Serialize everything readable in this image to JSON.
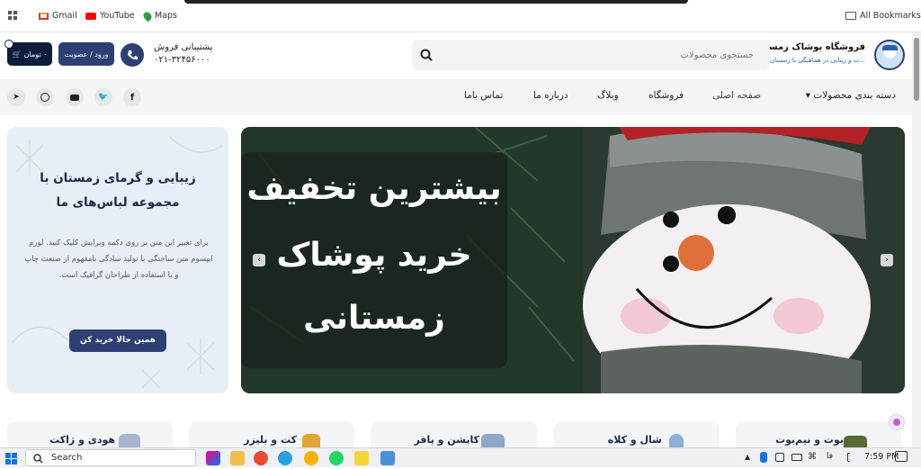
{
  "bookmarks": {
    "items": [
      {
        "label": "Gmail"
      },
      {
        "label": "YouTube"
      },
      {
        "label": "Maps"
      }
    ],
    "all_label": "All Bookmarks"
  },
  "header": {
    "logo_title": "فروشگاه پوشاک زمستانه",
    "logo_sub": "...ت و زیبایی در هماهنگی با زمستان",
    "search_placeholder": "جستجوی محصولات",
    "support_title": "پشتیبانی فروش",
    "support_phone": "۰۲۱-۳۲۴۵۶۰۰۰",
    "login_label": "ورود / عضویت",
    "cart_label": "۰ تومان",
    "cart_count": "۰"
  },
  "nav": {
    "categories_label": "دسته بندی محصولات",
    "items": [
      "صفحه اصلی",
      "فروشگاه",
      "وبلاگ",
      "درباره ما",
      "تماس باما"
    ]
  },
  "promo": {
    "title": "زیبایی و گرمای زمستان با مجموعه لباس‌های ما",
    "body": "برای تغییر این متن بر روی دکمه ویرایش کلیک کنید. لورم ایپسوم متن ساختگی با تولید سادگی نامفهوم از صنعت چاپ و با استفاده از طراحان گرافیک است.",
    "button": "همین حالا خرید کن"
  },
  "slider": {
    "lines": [
      "بیشترین تخفیف",
      "خرید پوشاک",
      "زمستانی"
    ]
  },
  "categories": [
    "بوت و نیم‌بوت",
    "شال و کلاه",
    "کاپشن و پافر",
    "کت و بلیزر",
    "هودی و ژاکت"
  ],
  "taskbar": {
    "search_label": "Search",
    "time": "7:59 PM",
    "lang": "فا"
  },
  "colors": {
    "primary": "#2e3f73",
    "dark": "#0f1d3c",
    "nav_bg": "#f4f5f7"
  }
}
